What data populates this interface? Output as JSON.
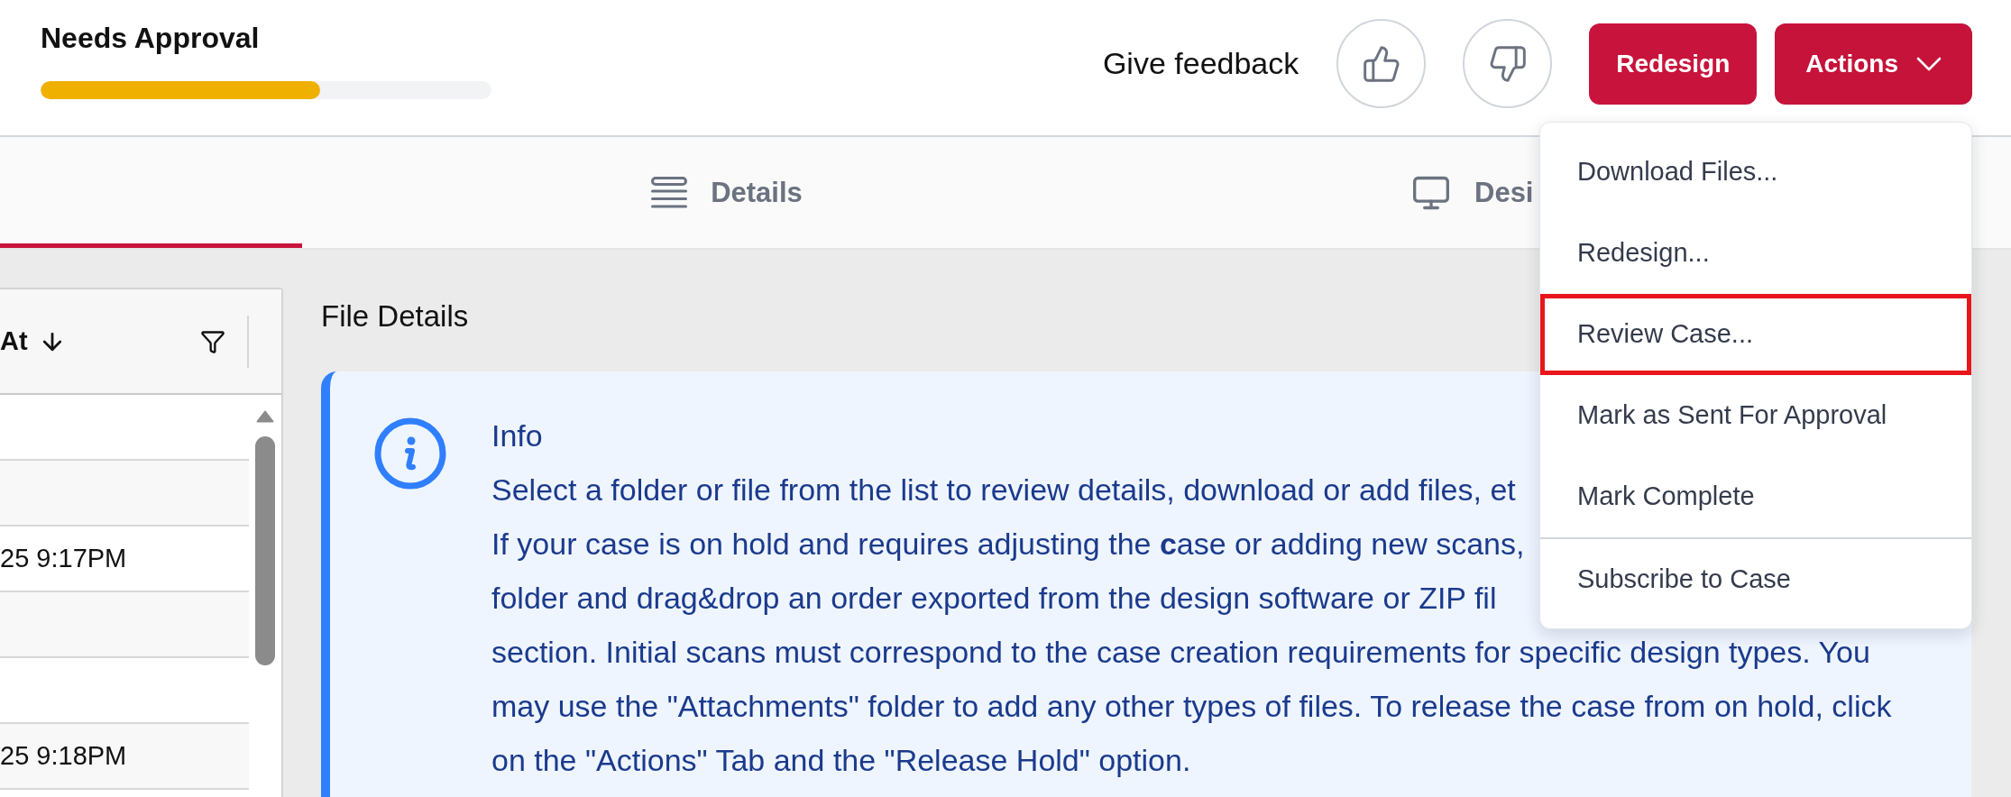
{
  "header": {
    "title": "Needs Approval",
    "progress": {
      "level": 0.62
    },
    "feedback_label": "Give feedback",
    "buttons": [
      {
        "label": "Redesign",
        "kind": "plain"
      },
      {
        "label": "Actions",
        "kind": "menu",
        "expanded": true,
        "menu": {
          "groups": [
            {
              "items": [
                {
                  "label": "Download Files...",
                  "highlighted": false
                },
                {
                  "label": "Redesign...",
                  "highlighted": false
                },
                {
                  "label": "Review Case...",
                  "highlighted": true
                },
                {
                  "label": "Mark as Sent For Approval",
                  "highlighted": false
                },
                {
                  "label": "Mark Complete",
                  "highlighted": false
                }
              ]
            },
            {
              "items": [
                {
                  "label": "Subscribe to Case",
                  "highlighted": false
                }
              ]
            }
          ]
        }
      }
    ]
  },
  "tabs": [
    {
      "selected": true
    },
    {
      "label": "Details",
      "kind": "details",
      "selected": false
    },
    {
      "label": "Desi",
      "kind": "design",
      "selected": false
    }
  ],
  "grid": {
    "columns": [
      {
        "label": "At",
        "sorted_descending": true
      }
    ],
    "rows": [
      {},
      {},
      {
        "column_1": "25 9:17PM"
      },
      {},
      {},
      {
        "column_1": "25 9:18PM"
      }
    ]
  },
  "file_details": {
    "title": "File Details",
    "info": {
      "title": "Info",
      "lines": [
        "Select a folder or file from the list to review details, download or add files, et",
        "If your case is on hold and requires adjusting the **c**ase or adding new scans,",
        "folder and drag&drop an order exported from the design software or ZIP fil",
        "section. Initial scans must correspond to the case creation requirements for specific design types. You",
        "may use the \"Attachments\" folder to add any other types of files. To release the case from on hold, click",
        "on the \"Actions\" Tab and the \"Release Hold\" option."
      ]
    }
  }
}
